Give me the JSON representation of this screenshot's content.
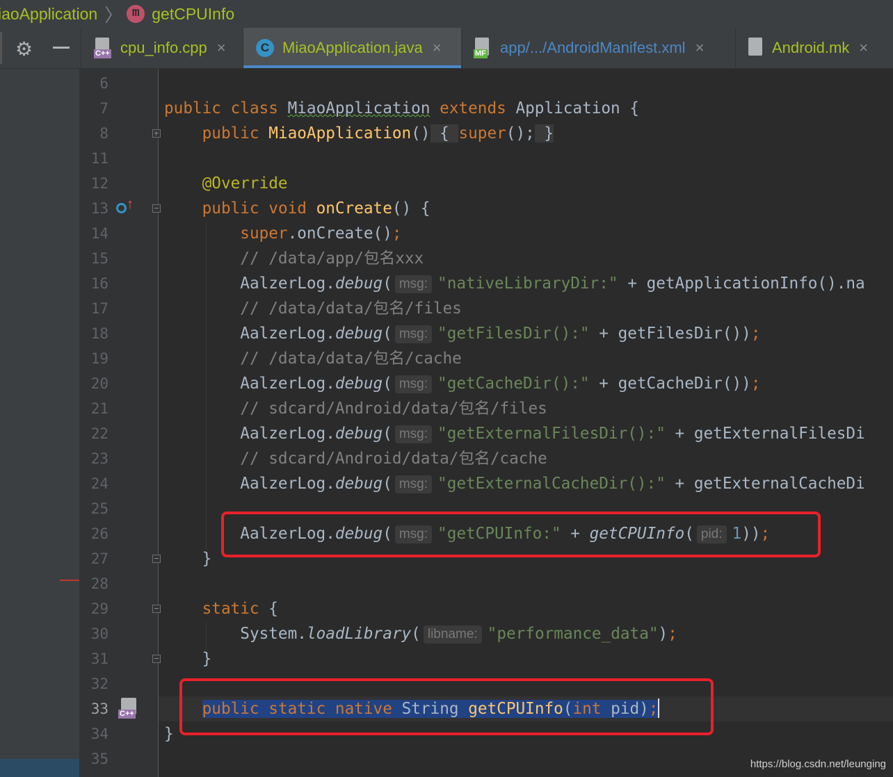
{
  "breadcrumb": {
    "class_name": "iaoApplication",
    "method_icon": "method-icon",
    "method_letter": "m",
    "method_name": "getCPUInfo"
  },
  "toolbar": {
    "settings_icon": "gear-icon",
    "hide_icon": "minus-icon"
  },
  "tabs": [
    {
      "label": "cpu_info.cpp",
      "icon": "cpp-file-icon",
      "badge": "C++",
      "color": "#a8c023",
      "active": false
    },
    {
      "label": "MiaoApplication.java",
      "icon": "java-class-icon",
      "badge": "C",
      "color": "#a8c023",
      "active": true
    },
    {
      "label": "app/.../AndroidManifest.xml",
      "icon": "manifest-file-icon",
      "badge": "MF",
      "color": "#4a88c7",
      "active": false
    },
    {
      "label": "Android.mk",
      "icon": "text-file-icon",
      "badge": "",
      "color": "#a8c023",
      "active": false
    }
  ],
  "tab_close_glyph": "×",
  "lines": {
    "l6": "6",
    "l7": "7",
    "l8": "8",
    "l11": "11",
    "l12": "12",
    "l13": "13",
    "l14": "14",
    "l15": "15",
    "l16": "16",
    "l17": "17",
    "l18": "18",
    "l19": "19",
    "l20": "20",
    "l21": "21",
    "l22": "22",
    "l23": "23",
    "l24": "24",
    "l25": "25",
    "l26": "26",
    "l27": "27",
    "l28": "28",
    "l29": "29",
    "l30": "30",
    "l31": "31",
    "l32": "32",
    "l33": "33",
    "l34": "34",
    "l35": "35"
  },
  "code": {
    "kw_public": "public",
    "kw_class": "class",
    "kw_extends": "extends",
    "kw_super": "super",
    "kw_void": "void",
    "kw_static": "static",
    "kw_native": "native",
    "kw_int": "int",
    "class_name": "MiaoApplication",
    "parent_class": "Application",
    "annotation": "@Override",
    "method_oncreate": "onCreate",
    "on_create_call": "onCreate",
    "comment_15": "// /data/app/包名xxx",
    "comment_17": "// /data/data/包名/files",
    "comment_19": "// /data/data/包名/cache",
    "comment_21": "// sdcard/Android/data/包名/files",
    "comment_23": "// sdcard/Android/data/包名/cache",
    "log_class": "AalzerLog",
    "log_method": "debug",
    "hint_msg": "msg:",
    "hint_pid": "pid:",
    "hint_libname": "libname:",
    "str_16": "\"nativeLibraryDir:\"",
    "call_16": "getApplicationInfo().na",
    "str_18": "\"getFilesDir():\"",
    "call_18": "getFilesDir()",
    "str_20": "\"getCacheDir():\"",
    "call_20": "getCacheDir()",
    "str_22": "\"getExternalFilesDir():\"",
    "call_22": "getExternalFilesDi",
    "str_24": "\"getExternalCacheDir():\"",
    "call_24": "getExternalCacheDi",
    "str_26": "\"getCPUInfo:\"",
    "call_26": "getCPUInfo",
    "num_26": "1",
    "system_class": "System",
    "load_library": "loadLibrary",
    "str_30": "\"performance_data\"",
    "string_type": "String",
    "native_method": "getCPUInfo",
    "param_pid": "pid"
  },
  "gutter_icons": {
    "line_13": "override-method-icon",
    "line_33": "cpp-implementation-icon"
  },
  "watermark": "https://blog.csdn.net/leunging",
  "colors": {
    "editor_bg": "#2b2b2b",
    "keyword": "#cc7832",
    "function": "#ffc66d",
    "string": "#6a8759",
    "comment": "#808080",
    "number": "#6897bb",
    "annotation": "#bbb529",
    "highlight_box": "#e8212a",
    "selection": "#214283"
  }
}
